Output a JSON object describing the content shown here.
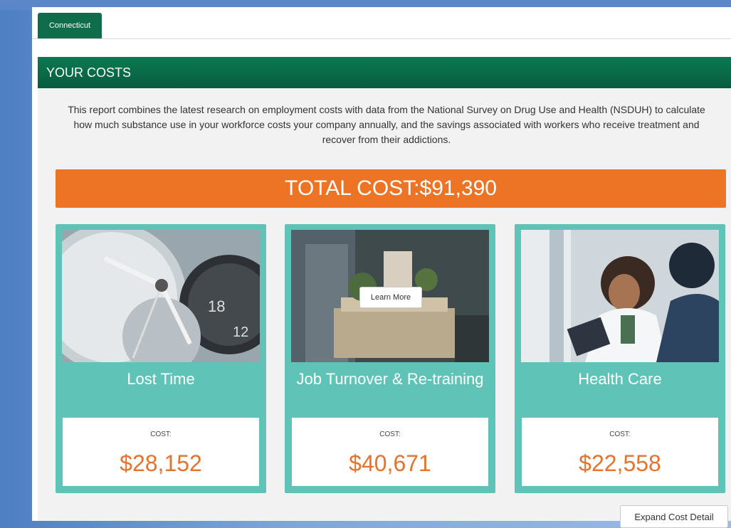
{
  "tabs": {
    "active": "Connecticut"
  },
  "panel": {
    "title": "YOUR COSTS",
    "intro": "This report combines the latest research on employment costs with data from the National Survey on Drug Use and Health (NSDUH) to calculate how much substance use in your workforce costs your company annually, and the savings associated with workers who receive treatment and recover from their addictions.",
    "total": "TOTAL COST:$91,390",
    "cards": [
      {
        "title": "Lost Time",
        "cost_label": "COST:",
        "cost": "$28,152",
        "image": "clock-photo"
      },
      {
        "title": "Job Turnover & Re-training",
        "cost_label": "COST:",
        "cost": "$40,671",
        "image": "box-carry-photo",
        "button": "Learn More"
      },
      {
        "title": "Health Care",
        "cost_label": "COST:",
        "cost": "$22,558",
        "image": "doctor-patient-photo"
      }
    ],
    "expand_button": "Expand Cost Detail"
  },
  "colors": {
    "header_green": "#0b7a52",
    "total_orange": "#ec7424",
    "card_teal": "#5fc4b7",
    "cost_orange": "#e8722a"
  }
}
